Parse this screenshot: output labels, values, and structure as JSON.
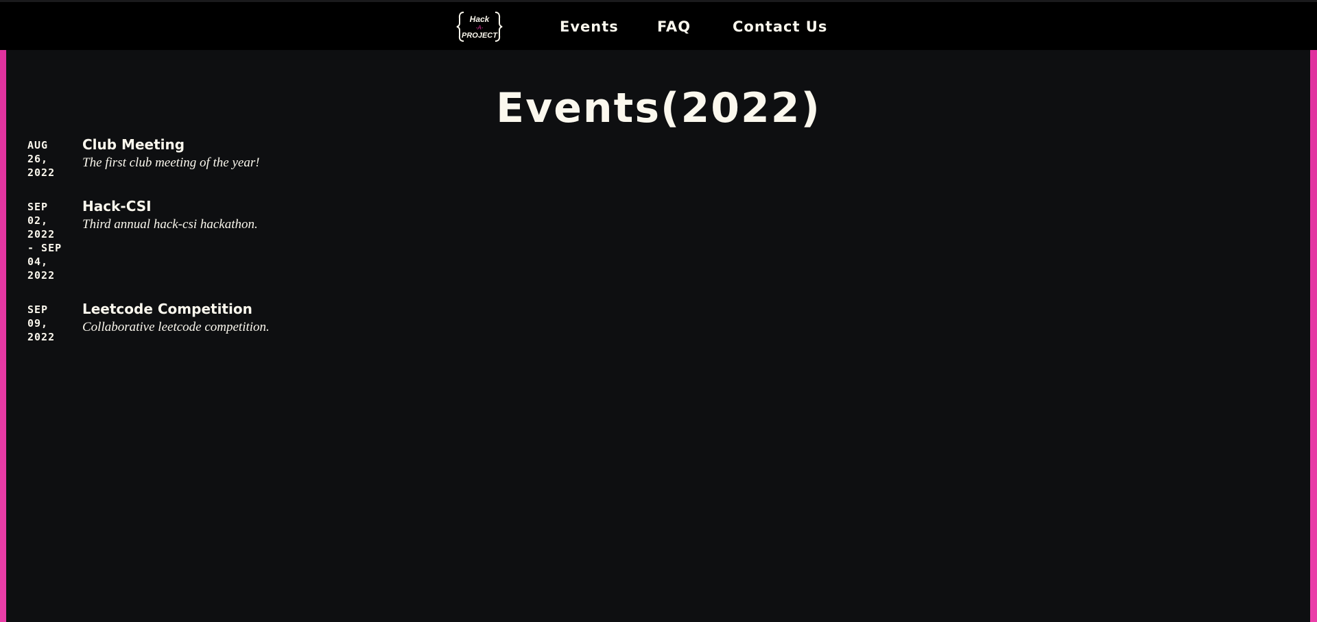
{
  "logo": {
    "line1": "Hack",
    "line2": "-A-",
    "line3": "PROJECT"
  },
  "nav": {
    "items": [
      {
        "label": "Events"
      },
      {
        "label": "FAQ"
      },
      {
        "label": "Contact Us"
      }
    ]
  },
  "page": {
    "title": "Events(2022)"
  },
  "events": [
    {
      "date": "AUG\n26,\n2022",
      "title": "Club Meeting",
      "description": "The first club meeting of the year!"
    },
    {
      "date": "SEP\n02,\n2022\n- SEP\n04,\n2022",
      "title": "Hack-CSI",
      "description": "Third annual hack-csi hackathon."
    },
    {
      "date": "SEP\n09,\n2022",
      "title": "Leetcode Competition",
      "description": "Collaborative leetcode competition."
    }
  ],
  "colors": {
    "background": "#0e0f11",
    "navbar": "#000000",
    "accent": "#e0329e",
    "text": "#fbf8ee"
  },
  "icons": {
    "logo": "hack-a-project-logo"
  }
}
